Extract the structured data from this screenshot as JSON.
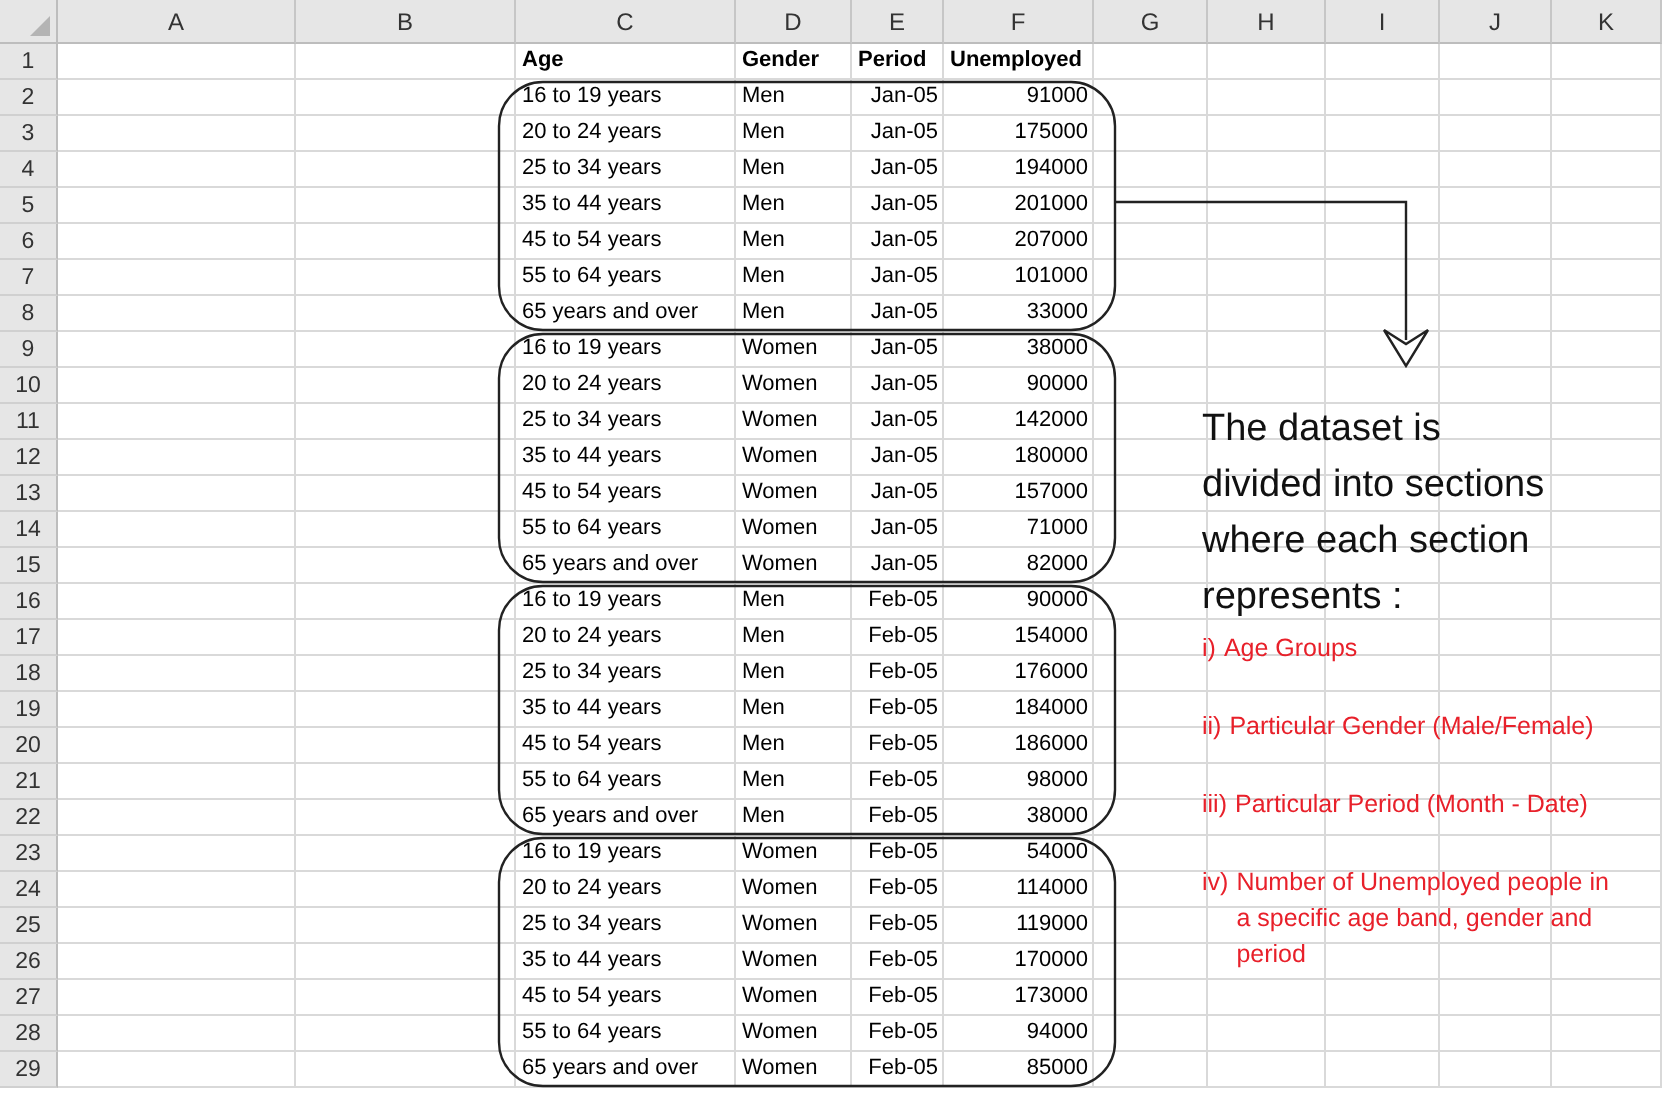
{
  "columns": [
    "A",
    "B",
    "C",
    "D",
    "E",
    "F",
    "G",
    "H",
    "I",
    "J",
    "K"
  ],
  "row_numbers": [
    "1",
    "2",
    "3",
    "4",
    "5",
    "6",
    "7",
    "8",
    "9",
    "10",
    "11",
    "12",
    "13",
    "14",
    "15",
    "16",
    "17",
    "18",
    "19",
    "20",
    "21",
    "22",
    "23",
    "24",
    "25",
    "26",
    "27",
    "28",
    "29"
  ],
  "header": [
    "Age",
    "Gender",
    "Period",
    "Unemployed"
  ],
  "sections": [
    {
      "rows": [
        {
          "age": "16 to 19 years",
          "gender": "Men",
          "period": "Jan-05",
          "unemployed": "91000"
        },
        {
          "age": "20 to 24 years",
          "gender": "Men",
          "period": "Jan-05",
          "unemployed": "175000"
        },
        {
          "age": "25 to 34 years",
          "gender": "Men",
          "period": "Jan-05",
          "unemployed": "194000"
        },
        {
          "age": "35 to 44 years",
          "gender": "Men",
          "period": "Jan-05",
          "unemployed": "201000"
        },
        {
          "age": "45 to 54 years",
          "gender": "Men",
          "period": "Jan-05",
          "unemployed": "207000"
        },
        {
          "age": "55 to 64 years",
          "gender": "Men",
          "period": "Jan-05",
          "unemployed": "101000"
        },
        {
          "age": "65 years and over",
          "gender": "Men",
          "period": "Jan-05",
          "unemployed": "33000"
        }
      ]
    },
    {
      "rows": [
        {
          "age": "16 to 19 years",
          "gender": "Women",
          "period": "Jan-05",
          "unemployed": "38000"
        },
        {
          "age": "20 to 24 years",
          "gender": "Women",
          "period": "Jan-05",
          "unemployed": "90000"
        },
        {
          "age": "25 to 34 years",
          "gender": "Women",
          "period": "Jan-05",
          "unemployed": "142000"
        },
        {
          "age": "35 to 44 years",
          "gender": "Women",
          "period": "Jan-05",
          "unemployed": "180000"
        },
        {
          "age": "45 to 54 years",
          "gender": "Women",
          "period": "Jan-05",
          "unemployed": "157000"
        },
        {
          "age": "55 to 64 years",
          "gender": "Women",
          "period": "Jan-05",
          "unemployed": "71000"
        },
        {
          "age": "65 years and over",
          "gender": "Women",
          "period": "Jan-05",
          "unemployed": "82000"
        }
      ]
    },
    {
      "rows": [
        {
          "age": "16 to 19 years",
          "gender": "Men",
          "period": "Feb-05",
          "unemployed": "90000"
        },
        {
          "age": "20 to 24 years",
          "gender": "Men",
          "period": "Feb-05",
          "unemployed": "154000"
        },
        {
          "age": "25 to 34 years",
          "gender": "Men",
          "period": "Feb-05",
          "unemployed": "176000"
        },
        {
          "age": "35 to 44 years",
          "gender": "Men",
          "period": "Feb-05",
          "unemployed": "184000"
        },
        {
          "age": "45 to 54 years",
          "gender": "Men",
          "period": "Feb-05",
          "unemployed": "186000"
        },
        {
          "age": "55 to 64 years",
          "gender": "Men",
          "period": "Feb-05",
          "unemployed": "98000"
        },
        {
          "age": "65 years and over",
          "gender": "Men",
          "period": "Feb-05",
          "unemployed": "38000"
        }
      ]
    },
    {
      "rows": [
        {
          "age": "16 to 19 years",
          "gender": "Women",
          "period": "Feb-05",
          "unemployed": "54000"
        },
        {
          "age": "20 to 24 years",
          "gender": "Women",
          "period": "Feb-05",
          "unemployed": "114000"
        },
        {
          "age": "25 to 34 years",
          "gender": "Women",
          "period": "Feb-05",
          "unemployed": "119000"
        },
        {
          "age": "35 to 44 years",
          "gender": "Women",
          "period": "Feb-05",
          "unemployed": "170000"
        },
        {
          "age": "45 to 54 years",
          "gender": "Women",
          "period": "Feb-05",
          "unemployed": "173000"
        },
        {
          "age": "55 to 64 years",
          "gender": "Women",
          "period": "Feb-05",
          "unemployed": "94000"
        },
        {
          "age": "65 years and over",
          "gender": "Women",
          "period": "Feb-05",
          "unemployed": "85000"
        }
      ]
    }
  ],
  "annotation": {
    "lines": [
      "The dataset is",
      "divided into sections",
      "where each section",
      "represents :"
    ],
    "items": [
      {
        "marker": "i)",
        "text": "Age Groups"
      },
      {
        "marker": "ii)",
        "text": "Particular Gender (Male/Female)"
      },
      {
        "marker": "iii)",
        "text": "Particular Period (Month - Date)"
      },
      {
        "marker": "iv)",
        "text": "Number of Unemployed people in a specific age band, gender and period"
      }
    ]
  }
}
